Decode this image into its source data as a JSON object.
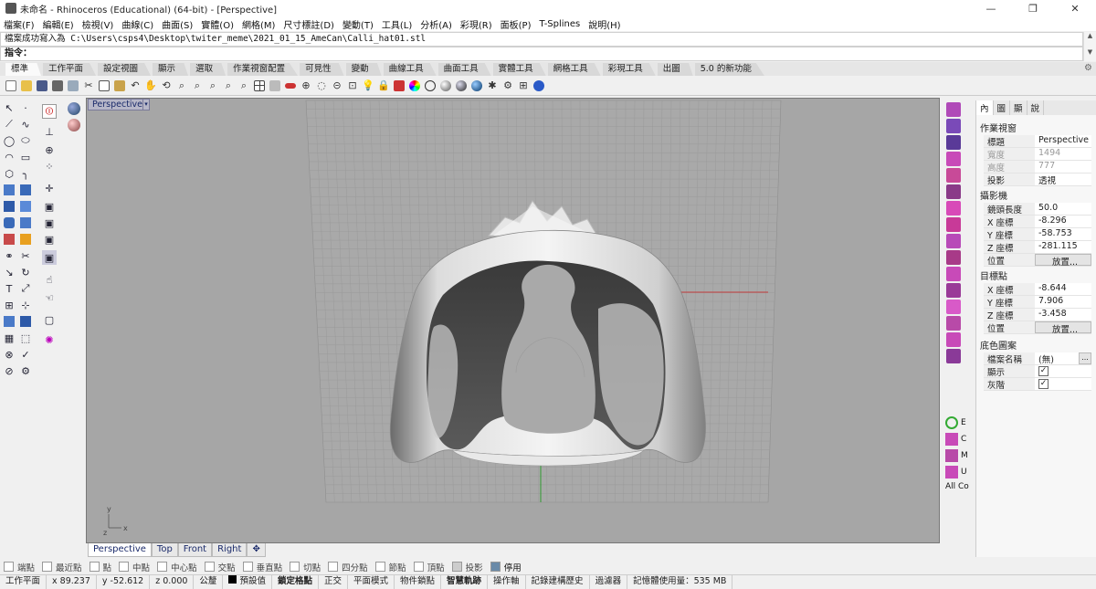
{
  "titlebar": {
    "title": "未命名 - Rhinoceros (Educational) (64-bit) - [Perspective]",
    "minimize": "—",
    "maximize": "❐",
    "close": "✕"
  },
  "menubar": [
    "檔案(F)",
    "編輯(E)",
    "檢視(V)",
    "曲線(C)",
    "曲面(S)",
    "實體(O)",
    "網格(M)",
    "尺寸標註(D)",
    "變動(T)",
    "工具(L)",
    "分析(A)",
    "彩現(R)",
    "面板(P)",
    "T-Splines",
    "說明(H)"
  ],
  "command": {
    "history": "檔案成功寫入為 C:\\Users\\csps4\\Desktop\\twiter_meme\\2021_01_15_AmeCan\\Calli_hat01.stl",
    "prompt": "指令：",
    "scroll_up": "▲",
    "scroll_down": "▼"
  },
  "toolbar_tabs": [
    "標準",
    "工作平面",
    "設定視圖",
    "顯示",
    "選取",
    "作業視窗配置",
    "可見性",
    "變動",
    "曲線工具",
    "曲面工具",
    "實體工具",
    "網格工具",
    "彩現工具",
    "出圖",
    "5.0 的新功能"
  ],
  "toolbar_gear": "⚙",
  "viewport": {
    "label": "Perspective",
    "dropdown": "▾",
    "axis_x": "x",
    "axis_y": "y",
    "axis_z": "z"
  },
  "viewport_tabs": [
    "Perspective",
    "Top",
    "Front",
    "Right",
    "✥"
  ],
  "panel": {
    "tabs": [
      "內",
      "圖",
      "顯",
      "說"
    ],
    "section_viewport": "作業視窗",
    "title_label": "標題",
    "title_value": "Perspective",
    "width_label": "寬度",
    "width_value": "1494",
    "height_label": "高度",
    "height_value": "777",
    "projection_label": "投影",
    "projection_value": "透視",
    "section_camera": "攝影機",
    "lens_label": "鏡頭長度",
    "lens_value": "50.0",
    "cam_x_label": "X 座標",
    "cam_x_value": "-8.296",
    "cam_y_label": "Y 座標",
    "cam_y_value": "-58.753",
    "cam_z_label": "Z 座標",
    "cam_z_value": "-281.115",
    "cam_pos_label": "位置",
    "cam_pos_button": "放置...",
    "section_target": "目標點",
    "tgt_x_label": "X 座標",
    "tgt_x_value": "-8.644",
    "tgt_y_label": "Y 座標",
    "tgt_y_value": "7.906",
    "tgt_z_label": "Z 座標",
    "tgt_z_value": "-3.458",
    "tgt_pos_label": "位置",
    "tgt_pos_button": "放置...",
    "section_wallpaper": "底色圖案",
    "file_label": "檔案名稱",
    "file_value": "(無)",
    "show_label": "顯示",
    "gray_label": "灰階",
    "check": "✓",
    "browse": "..."
  },
  "right_tool_labels": [
    "E",
    "C",
    "M",
    "U",
    "All Co"
  ],
  "osnap": [
    "端點",
    "最近點",
    "點",
    "中點",
    "中心點",
    "交點",
    "垂直點",
    "切點",
    "四分點",
    "節點",
    "頂點",
    "投影",
    "停用"
  ],
  "status": {
    "cplane": "工作平面",
    "x": "x 89.237",
    "y": "y -52.612",
    "z": "z 0.000",
    "units": "公釐",
    "layer": "預設值",
    "grid_snap": "鎖定格點",
    "ortho": "正交",
    "planar": "平面模式",
    "osnap": "物件鎖點",
    "smarttrack": "智慧軌跡",
    "gumball": "操作軸",
    "history": "記錄建構歷史",
    "filter": "過濾器",
    "memory": "記憶體使用量：535 MB"
  },
  "colors": {
    "viewport_bg": "#a6a6a6",
    "grid": "#9a9a9a",
    "axis_x": "#c23a3a",
    "axis_y": "#2e9a2e"
  }
}
